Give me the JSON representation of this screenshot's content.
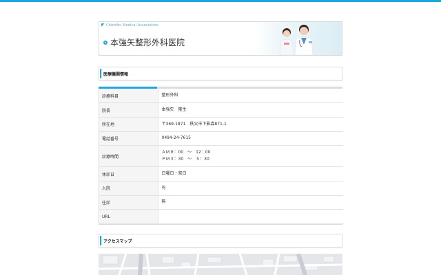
{
  "header": {
    "association_logo_text": "Chichibu Medical Association",
    "clinic_name": "本強矢整形外科医院",
    "accent_color": "#1ea7dd"
  },
  "info_section": {
    "heading": "医療機関情報",
    "rows": [
      {
        "label": "診療科目",
        "value": "整形外科"
      },
      {
        "label": "院長",
        "value": "本強矢　隆生"
      },
      {
        "label": "所在地",
        "value": "〒369-1871　秩父市下影森871-1"
      },
      {
        "label": "電話番号",
        "value": "0494-24-7615"
      },
      {
        "label": "診療時間",
        "value_line1": "ＡＭ９：00　～　12：00",
        "value_line2": "ＰＭ３：30　～　５：30"
      },
      {
        "label": "休診日",
        "value": "日曜日・祭日"
      },
      {
        "label": "入院",
        "value": "有"
      },
      {
        "label": "往診",
        "value": "無"
      },
      {
        "label": "URL",
        "value": ""
      }
    ]
  },
  "access_section": {
    "heading": "アクセスマップ"
  }
}
